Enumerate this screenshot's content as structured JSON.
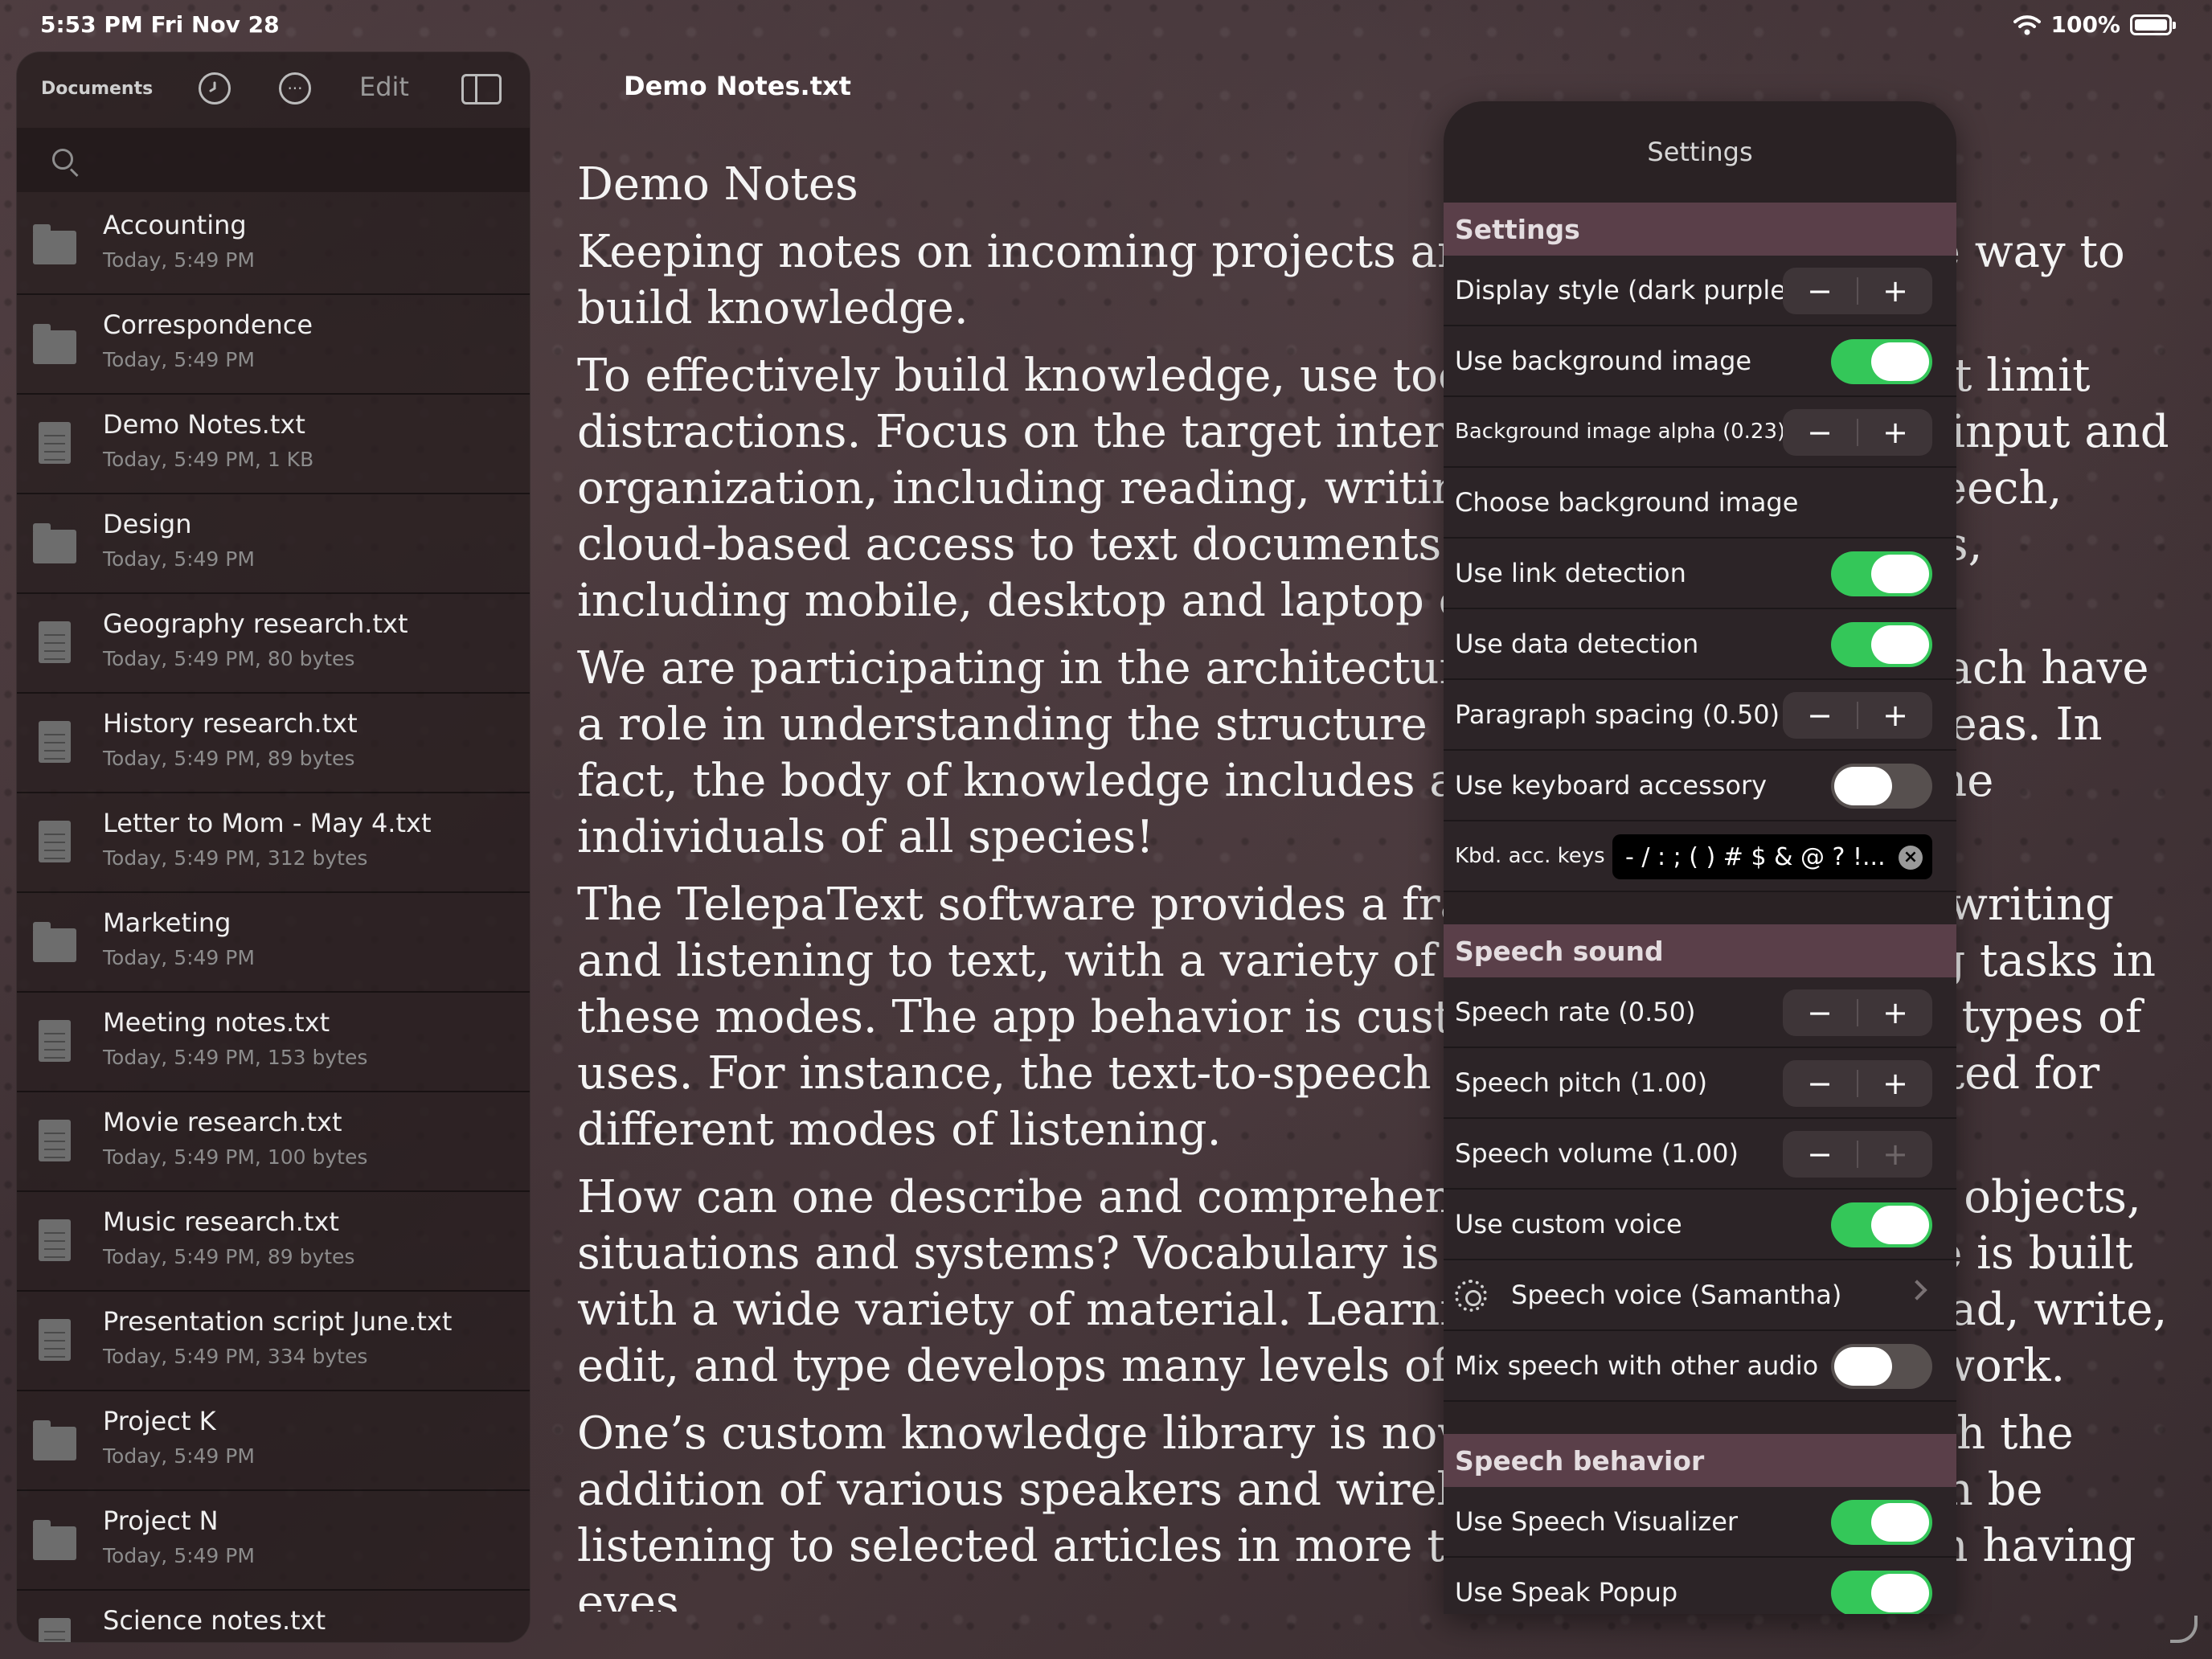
{
  "status_bar": {
    "time": "5:53 PM   Fri Nov 28",
    "battery": "100%"
  },
  "sidebar": {
    "documents_label": "Documents",
    "edit_label": "Edit",
    "items": [
      {
        "name": "Accounting",
        "meta": "Today, 5:49 PM",
        "kind": "folder"
      },
      {
        "name": "Correspondence",
        "meta": "Today, 5:49 PM",
        "kind": "folder"
      },
      {
        "name": "Demo Notes.txt",
        "meta": "Today, 5:49 PM, 1 KB",
        "kind": "document"
      },
      {
        "name": "Design",
        "meta": "Today, 5:49 PM",
        "kind": "folder"
      },
      {
        "name": "Geography research.txt",
        "meta": "Today, 5:49 PM, 80 bytes",
        "kind": "document"
      },
      {
        "name": "History research.txt",
        "meta": "Today, 5:49 PM, 89 bytes",
        "kind": "document"
      },
      {
        "name": "Letter to Mom - May 4.txt",
        "meta": "Today, 5:49 PM, 312 bytes",
        "kind": "document"
      },
      {
        "name": "Marketing",
        "meta": "Today, 5:49 PM",
        "kind": "folder"
      },
      {
        "name": "Meeting notes.txt",
        "meta": "Today, 5:49 PM, 153 bytes",
        "kind": "document"
      },
      {
        "name": "Movie research.txt",
        "meta": "Today, 5:49 PM, 100 bytes",
        "kind": "document"
      },
      {
        "name": "Music research.txt",
        "meta": "Today, 5:49 PM, 89 bytes",
        "kind": "document"
      },
      {
        "name": "Presentation script June.txt",
        "meta": "Today, 5:49 PM, 334 bytes",
        "kind": "document"
      },
      {
        "name": "Project K",
        "meta": "Today, 5:49 PM",
        "kind": "folder"
      },
      {
        "name": "Project N",
        "meta": "Today, 5:49 PM",
        "kind": "folder"
      },
      {
        "name": "Science notes.txt",
        "meta": "",
        "kind": "document"
      }
    ]
  },
  "document": {
    "filename": "Demo Notes.txt",
    "heading": "Demo Notes",
    "paragraphs": [
      "Keeping notes on incoming projects and ideas is an effective way to build knowledge.",
      "To effectively build knowledge, use tools and techniques that limit distractions. Focus on the target interests, with a variety of input and organization, including reading, writing, and listening to speech, cloud-based access to text documents on a variety of devices, including mobile, desktop and laptop computers.",
      "We are participating in the architecture of knowledge. We each have a role in understanding the structure and development of ideas. In fact, the body of knowledge includes all of the thoughts of the individuals of all species!",
      "The TelepaText software provides a framework for reading, writing and listening to text, with a variety of actions for performing tasks in these modes. The app behavior is customizable for different types of uses. For instance, the text-to-speech behavior can be adjusted for different modes of listening.",
      "How can one describe and comprehend the variety of ideas, objects, situations and systems? Vocabulary is important. Knowledge is built with a wide variety of material. Learning to listen, speak, read, write, edit, and type develops many levels of knowing how things work.",
      "One’s custom knowledge library is now more accessible, with the addition of various speakers and wireless headphones. It can be listening to selected articles in more time periods than when having eyes"
    ]
  },
  "settings": {
    "title": "Settings",
    "sections": [
      {
        "header": "Settings",
        "rows": [
          {
            "label": "Display style (dark purple)",
            "control": "stepper"
          },
          {
            "label": "Use background image",
            "control": "toggle",
            "on": true
          },
          {
            "label": "Background image alpha (0.23)",
            "control": "stepper",
            "small": true
          },
          {
            "label": "Choose background image",
            "control": "none"
          },
          {
            "label": "Use link detection",
            "control": "toggle",
            "on": true
          },
          {
            "label": "Use data detection",
            "control": "toggle",
            "on": true
          },
          {
            "label": "Paragraph spacing (0.50)",
            "control": "stepper"
          },
          {
            "label": "Use keyboard accessory",
            "control": "toggle",
            "on": false
          },
          {
            "label": "Kbd. acc. keys",
            "control": "text",
            "value": "- / : ; ( ) # $ & @ ? !...",
            "small": true
          }
        ]
      },
      {
        "header": "Speech sound",
        "rows": [
          {
            "label": "Speech rate (0.50)",
            "control": "stepper"
          },
          {
            "label": "Speech pitch (1.00)",
            "control": "stepper"
          },
          {
            "label": "Speech volume (1.00)",
            "control": "stepper",
            "plus_disabled": true
          },
          {
            "label": "Use custom voice",
            "control": "toggle",
            "on": true
          },
          {
            "label": "Speech voice (Samantha)",
            "control": "disclosure",
            "icon": "gear-icon"
          },
          {
            "label": "Mix speech with other audio",
            "control": "toggle",
            "on": false
          }
        ]
      },
      {
        "header": "Speech behavior",
        "rows": [
          {
            "label": "Use Speech Visualizer",
            "control": "toggle",
            "on": true
          },
          {
            "label": "Use Speak Popup",
            "control": "toggle",
            "on": true
          }
        ]
      }
    ]
  },
  "icons": {
    "minus": "−",
    "plus": "+",
    "clear": "×",
    "ellipsis": "···"
  },
  "colors": {
    "toggle_on": "#34c759",
    "section_header": "#5a3f49",
    "popover_bg": "#2a2224"
  }
}
